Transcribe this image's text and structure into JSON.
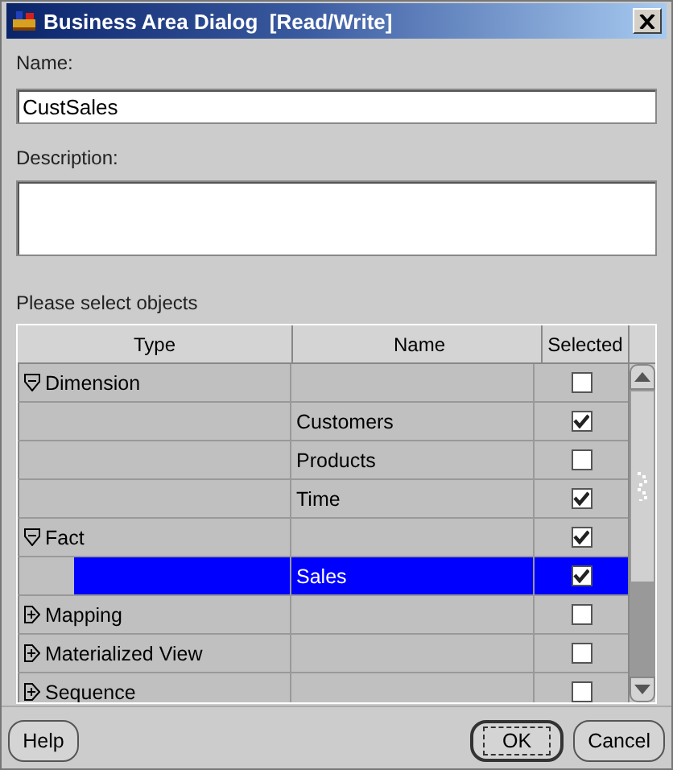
{
  "window": {
    "title": "Business Area Dialog  [Read/Write]"
  },
  "name_field": {
    "label": "Name:",
    "value": "CustSales"
  },
  "description_field": {
    "label": "Description:"
  },
  "table": {
    "caption": "Please select objects",
    "columns": [
      "Type",
      "Name",
      "Selected"
    ],
    "rows": [
      {
        "type": "Dimension",
        "expanded": true,
        "checked": false,
        "children": [
          {
            "name": "Customers",
            "checked": true,
            "selected": false
          },
          {
            "name": "Products",
            "checked": false,
            "selected": false
          },
          {
            "name": "Time",
            "checked": true,
            "selected": false
          }
        ]
      },
      {
        "type": "Fact",
        "expanded": true,
        "checked": true,
        "children": [
          {
            "name": "Sales",
            "checked": true,
            "selected": true
          }
        ]
      },
      {
        "type": "Mapping",
        "expanded": false,
        "checked": false
      },
      {
        "type": "Materialized View",
        "expanded": false,
        "checked": false
      },
      {
        "type": "Sequence",
        "expanded": false,
        "checked": false
      }
    ]
  },
  "left_buttons": [
    {
      "label": "Help",
      "focused": false
    }
  ],
  "right_buttons": [
    {
      "label": "OK",
      "focused": true
    },
    {
      "label": "Cancel",
      "focused": false
    }
  ]
}
